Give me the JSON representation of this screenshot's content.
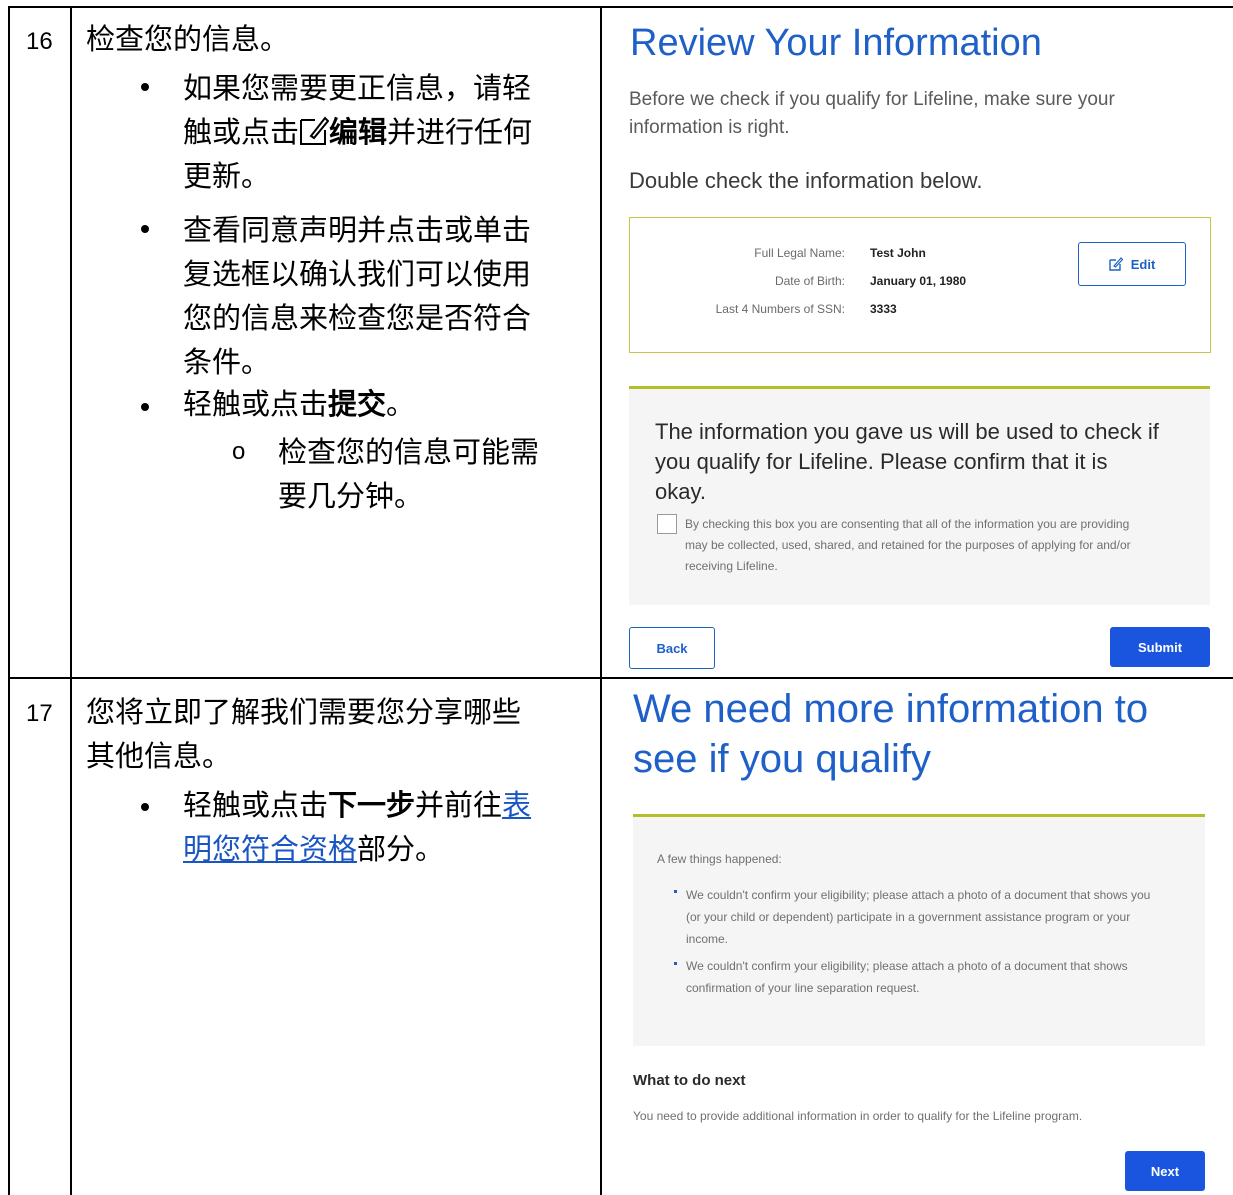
{
  "rows": [
    {
      "number": "16",
      "intro": "检查您的信息。",
      "bullet1_lines": [
        "如果您需要更正信息，请轻",
        "触或点击",
        "编辑",
        "并进行任何",
        "更新。"
      ],
      "bullet2_lines": [
        "查看同意声明并点击或单击",
        "复选框以确认我们可以使用",
        "您的信息来检查您是否符合",
        "条件。"
      ],
      "bullet3_prefix": "轻触或点击",
      "bullet3_bold": "提交",
      "bullet3_suffix": "。",
      "sub_bullet_marker": "o",
      "sub_lines": [
        "检查您的信息可能需",
        "要几分钟。"
      ]
    },
    {
      "number": "17",
      "intro_lines": [
        "您将立即了解我们需要您分享哪些",
        "其他信息。"
      ],
      "bullet_prefix": "轻触或点击",
      "bullet_bold": "下一步",
      "bullet_mid": "并前往",
      "bullet_link_1": "表",
      "bullet_link_2": "明您符合资格",
      "bullet_suffix": "部分。"
    }
  ],
  "review": {
    "title": "Review Your Information",
    "subtitle_lines": [
      "Before we check if you qualify for Lifeline, make sure your",
      "information is right."
    ],
    "double_check": "Double check the information below.",
    "fields": [
      {
        "label": "Full Legal Name:",
        "value": "Test John"
      },
      {
        "label": "Date of Birth:",
        "value": "January 01, 1980"
      },
      {
        "label": "Last 4 Numbers of SSN:",
        "value": "3333"
      }
    ],
    "edit_label": "Edit",
    "consent_heading_lines": [
      "The information you gave us will be used to check if",
      "you qualify for Lifeline. Please confirm that it is",
      "okay."
    ],
    "consent_text_lines": [
      "By checking this box you are consenting that all of the information you are providing",
      "may be collected, used, shared, and retained for the purposes of applying for and/or",
      "receiving Lifeline."
    ],
    "back_label": "Back",
    "submit_label": "Submit"
  },
  "more_info": {
    "title_lines": [
      "We need more information to",
      "see if you qualify"
    ],
    "intro": "A few things happened:",
    "item1_lines": [
      "We couldn't confirm your eligibility; please attach a photo of a document that shows you",
      "(or your child or dependent) participate in a government assistance program or your",
      "income."
    ],
    "item2_lines": [
      "We couldn't confirm your eligibility; please attach a photo of a document that shows",
      "confirmation of your line separation request."
    ],
    "next_heading": "What to do next",
    "next_text": "You need to provide additional information in order to qualify for the Lifeline program.",
    "next_label": "Next"
  },
  "colors": {
    "title_blue": "#1f60c8",
    "button_blue": "#1a55e0",
    "accent_olive": "#b5bd2a",
    "link_blue": "#1a55c4"
  }
}
